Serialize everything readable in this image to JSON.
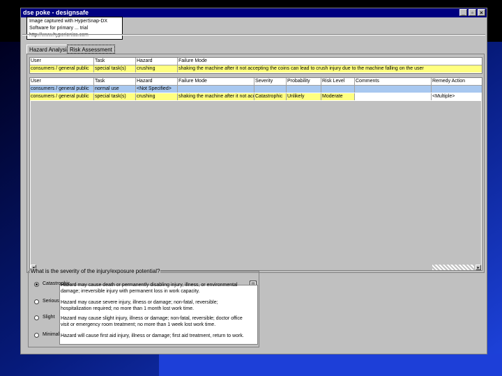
{
  "window": {
    "title": "dse poke - designsafe"
  },
  "tooltip": {
    "line1": "Image captured with HyperSnap-DX",
    "line2": "Software for primary ... trial",
    "line3": "http://www.hyperionics.com"
  },
  "tabs": [
    {
      "label": "Hazard Analysis"
    },
    {
      "label": "Risk Assessment"
    }
  ],
  "top_table": {
    "headers": [
      "User",
      "Task",
      "Hazard",
      "Failure Mode"
    ],
    "row": [
      "consumers / general public",
      "special task(s)",
      "crushing",
      "shaking the machine after it not accepting the coins can lead to crush injury due to the machine falling on the user"
    ]
  },
  "risk_table": {
    "headers": [
      "User",
      "Task",
      "Hazard",
      "Failure Mode",
      "Severity",
      "Probability",
      "Risk Level",
      "Comments",
      "Remedy Action"
    ],
    "rows": [
      [
        "consumers / general public",
        "normal use",
        "<Not Specified>",
        "",
        "",
        "",
        "",
        "",
        ""
      ],
      [
        "consumers / general public",
        "special task(s)",
        "crushing",
        "shaking the machine after it not acc",
        "Catastrophic",
        "Unlikely",
        "Moderate",
        "",
        "<Multiple>"
      ]
    ]
  },
  "question": "What is the severity of the injury/exposure potential?",
  "options": [
    {
      "label": "Catastrophic",
      "selected": true,
      "desc": "Hazard may cause death or permanently disabling injury, illness, or environmental damage; irreversible injury with permanent loss in work capacity."
    },
    {
      "label": "Serious",
      "selected": false,
      "desc": "Hazard may cause severe injury, illness or damage; non-fatal, reversible; hospitalization required; no more than 1 month lost work time."
    },
    {
      "label": "Slight",
      "selected": false,
      "desc": "Hazard may cause slight injury, illness or damage; non-fatal, reversible; doctor office visit or emergency room treatment; no more than 1 week lost work time."
    },
    {
      "label": "Minimal",
      "selected": false,
      "desc": "Hazard will cause first aid injury, illness or damage; first aid treatment, return to work."
    }
  ],
  "colors": {
    "title_bar": "#000080",
    "slide_blue": "#1c3fd0",
    "highlight_yellow": "#ffff80",
    "highlight_blue": "#a8c8f0"
  }
}
